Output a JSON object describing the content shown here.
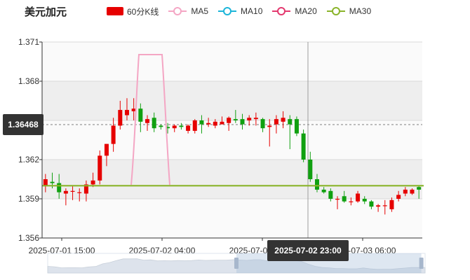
{
  "header": {
    "title": "美元加元"
  },
  "legend": [
    {
      "label": "60分K线",
      "color": "#e60000",
      "kind": "rect"
    },
    {
      "label": "MA5",
      "color": "#f4a6c4",
      "kind": "line"
    },
    {
      "label": "MA10",
      "color": "#1cb5d9",
      "kind": "line"
    },
    {
      "label": "MA20",
      "color": "#e3386e",
      "kind": "line"
    },
    {
      "label": "MA30",
      "color": "#8ab42a",
      "kind": "line"
    }
  ],
  "pointer": {
    "y_label": "1.36468",
    "x_label": "2025-07-02 23:00"
  },
  "chart_data": {
    "type": "candlestick",
    "y_ticks": [
      "1.356",
      "1.359",
      "1.362",
      "1.365",
      "1.368",
      "1.371"
    ],
    "x_ticks": [
      "2025-07-01 15:00",
      "2025-07-02 04:00",
      "2025-07-02 17:00",
      "2025-07-03 06:00"
    ],
    "ylim": [
      1.356,
      1.371
    ],
    "candles": [
      [
        1.36,
        1.3605,
        1.3595,
        1.3609
      ],
      [
        1.3603,
        1.3602,
        1.3598,
        1.361
      ],
      [
        1.3602,
        1.3595,
        1.359,
        1.3609
      ],
      [
        1.3594,
        1.3596,
        1.3585,
        1.3598
      ],
      [
        1.3596,
        1.3596,
        1.3589,
        1.36
      ],
      [
        1.3595,
        1.3595,
        1.3588,
        1.3598
      ],
      [
        1.3594,
        1.3601,
        1.3588,
        1.3604
      ],
      [
        1.3601,
        1.3604,
        1.3599,
        1.361
      ],
      [
        1.3604,
        1.3623,
        1.3601,
        1.3627
      ],
      [
        1.3623,
        1.3632,
        1.3615,
        1.3632
      ],
      [
        1.3632,
        1.3646,
        1.3626,
        1.3652
      ],
      [
        1.3646,
        1.3658,
        1.3643,
        1.3665
      ],
      [
        1.3654,
        1.3658,
        1.365,
        1.3667
      ],
      [
        1.3657,
        1.3659,
        1.365,
        1.3667
      ],
      [
        1.3659,
        1.3649,
        1.3641,
        1.3663
      ],
      [
        1.3648,
        1.3651,
        1.3642,
        1.3654
      ],
      [
        1.3652,
        1.3644,
        1.3641,
        1.3656
      ],
      [
        1.3646,
        1.3645,
        1.3643,
        1.3647
      ],
      [
        1.3645,
        1.3644,
        1.364,
        1.3648
      ],
      [
        1.3644,
        1.3646,
        1.3641,
        1.3647
      ],
      [
        1.3646,
        1.3645,
        1.3643,
        1.3648
      ],
      [
        1.3642,
        1.3646,
        1.364,
        1.3647
      ],
      [
        1.3642,
        1.365,
        1.364,
        1.3651
      ],
      [
        1.365,
        1.3647,
        1.364,
        1.3654
      ],
      [
        1.3647,
        1.3648,
        1.3645,
        1.3652
      ],
      [
        1.3646,
        1.3649,
        1.3644,
        1.3651
      ],
      [
        1.3647,
        1.3649,
        1.3647,
        1.3653
      ],
      [
        1.3648,
        1.3652,
        1.3642,
        1.3653
      ],
      [
        1.3651,
        1.365,
        1.3648,
        1.3658
      ],
      [
        1.3651,
        1.3647,
        1.3643,
        1.3655
      ],
      [
        1.365,
        1.3652,
        1.3646,
        1.3654
      ],
      [
        1.3651,
        1.3652,
        1.3646,
        1.3656
      ],
      [
        1.3651,
        1.3644,
        1.3641,
        1.3652
      ],
      [
        1.3645,
        1.3646,
        1.363,
        1.3651
      ],
      [
        1.3647,
        1.3651,
        1.364,
        1.3654
      ],
      [
        1.3649,
        1.3652,
        1.3644,
        1.3657
      ],
      [
        1.3651,
        1.3647,
        1.3628,
        1.3654
      ],
      [
        1.3651,
        1.364,
        1.3638,
        1.3653
      ],
      [
        1.364,
        1.362,
        1.3618,
        1.3643
      ],
      [
        1.362,
        1.3605,
        1.3603,
        1.3626
      ],
      [
        1.3605,
        1.3597,
        1.3595,
        1.3609
      ],
      [
        1.3597,
        1.3595,
        1.3594,
        1.3599
      ],
      [
        1.3596,
        1.359,
        1.3588,
        1.3598
      ],
      [
        1.359,
        1.359,
        1.3582,
        1.3592
      ],
      [
        1.3592,
        1.3588,
        1.3587,
        1.3596
      ],
      [
        1.3588,
        1.3588,
        1.3585,
        1.3591
      ],
      [
        1.3588,
        1.3594,
        1.3587,
        1.3596
      ],
      [
        1.359,
        1.3588,
        1.3586,
        1.3592
      ],
      [
        1.3588,
        1.3584,
        1.3582,
        1.3589
      ],
      [
        1.3584,
        1.3585,
        1.358,
        1.3586
      ],
      [
        1.3585,
        1.3585,
        1.3578,
        1.3589
      ],
      [
        1.3582,
        1.3589,
        1.358,
        1.3591
      ],
      [
        1.359,
        1.3593,
        1.3588,
        1.3596
      ],
      [
        1.3594,
        1.3597,
        1.3592,
        1.3599
      ],
      [
        1.3594,
        1.3597,
        1.3593,
        1.3598
      ],
      [
        1.3599,
        1.3597,
        1.359,
        1.36
      ]
    ],
    "ma5": [
      [
        1.36,
        1.36
      ],
      [
        1.36,
        1.36
      ],
      [
        1.36,
        1.36
      ],
      [
        1.36,
        1.36
      ],
      [
        1.36,
        1.36
      ],
      [
        1.36,
        1.36
      ],
      [
        1.36,
        1.36
      ],
      [
        1.36,
        1.36
      ],
      [
        1.36,
        1.36
      ],
      [
        1.36,
        1.36
      ],
      [
        1.36,
        1.36
      ],
      [
        1.36,
        1.36
      ],
      [
        1.36,
        1.36
      ],
      [
        1.366,
        1.3675
      ],
      [
        1.37,
        1.37
      ],
      [
        1.37,
        1.37
      ],
      [
        1.37,
        1.37
      ],
      [
        1.37,
        1.37
      ],
      [
        1.365,
        1.37
      ],
      [
        1.36,
        1.36
      ]
    ],
    "ma30_level": 1.36
  },
  "slider": {
    "range": [
      0.5,
      0.99
    ]
  }
}
